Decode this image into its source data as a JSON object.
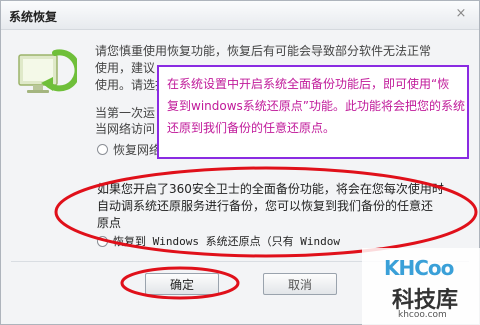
{
  "window": {
    "title": "系统恢复",
    "close_glyph": "×"
  },
  "description_lines": [
    "请您慎重使用恢复功能，恢复后有可能会导致部分软件无法正常",
    "使用，建议",
    "使用。请选择"
  ],
  "section1": {
    "lines": [
      "当第一次运",
      "当网络访问"
    ],
    "radio_label": "恢复网络"
  },
  "callout": {
    "lines": [
      "在系统设置中开启系统全面备份功能后，即可使用“恢",
      "复到windows系统还原点”功能。此功能将会把您的系统",
      "还原到我们备份的任意还原点。"
    ],
    "border_color": "#8a2be2",
    "text_color": "#c01a9a"
  },
  "section2": {
    "lines": [
      "如果您开启了360安全卫士的全面备份功能，将会在您每次使用时",
      "自动调系统还原服务进行备份，您可以恢复到我们备份的任意还",
      "原点"
    ],
    "radio_label": "恢复到 Windows 系统还原点（只有 Window"
  },
  "buttons": {
    "ok": "确定",
    "cancel": "取消"
  },
  "annotation_color": "#e0101a",
  "watermark": {
    "brand": "KHCoo",
    "cn": "科技库",
    "url": "khcoo.com"
  }
}
